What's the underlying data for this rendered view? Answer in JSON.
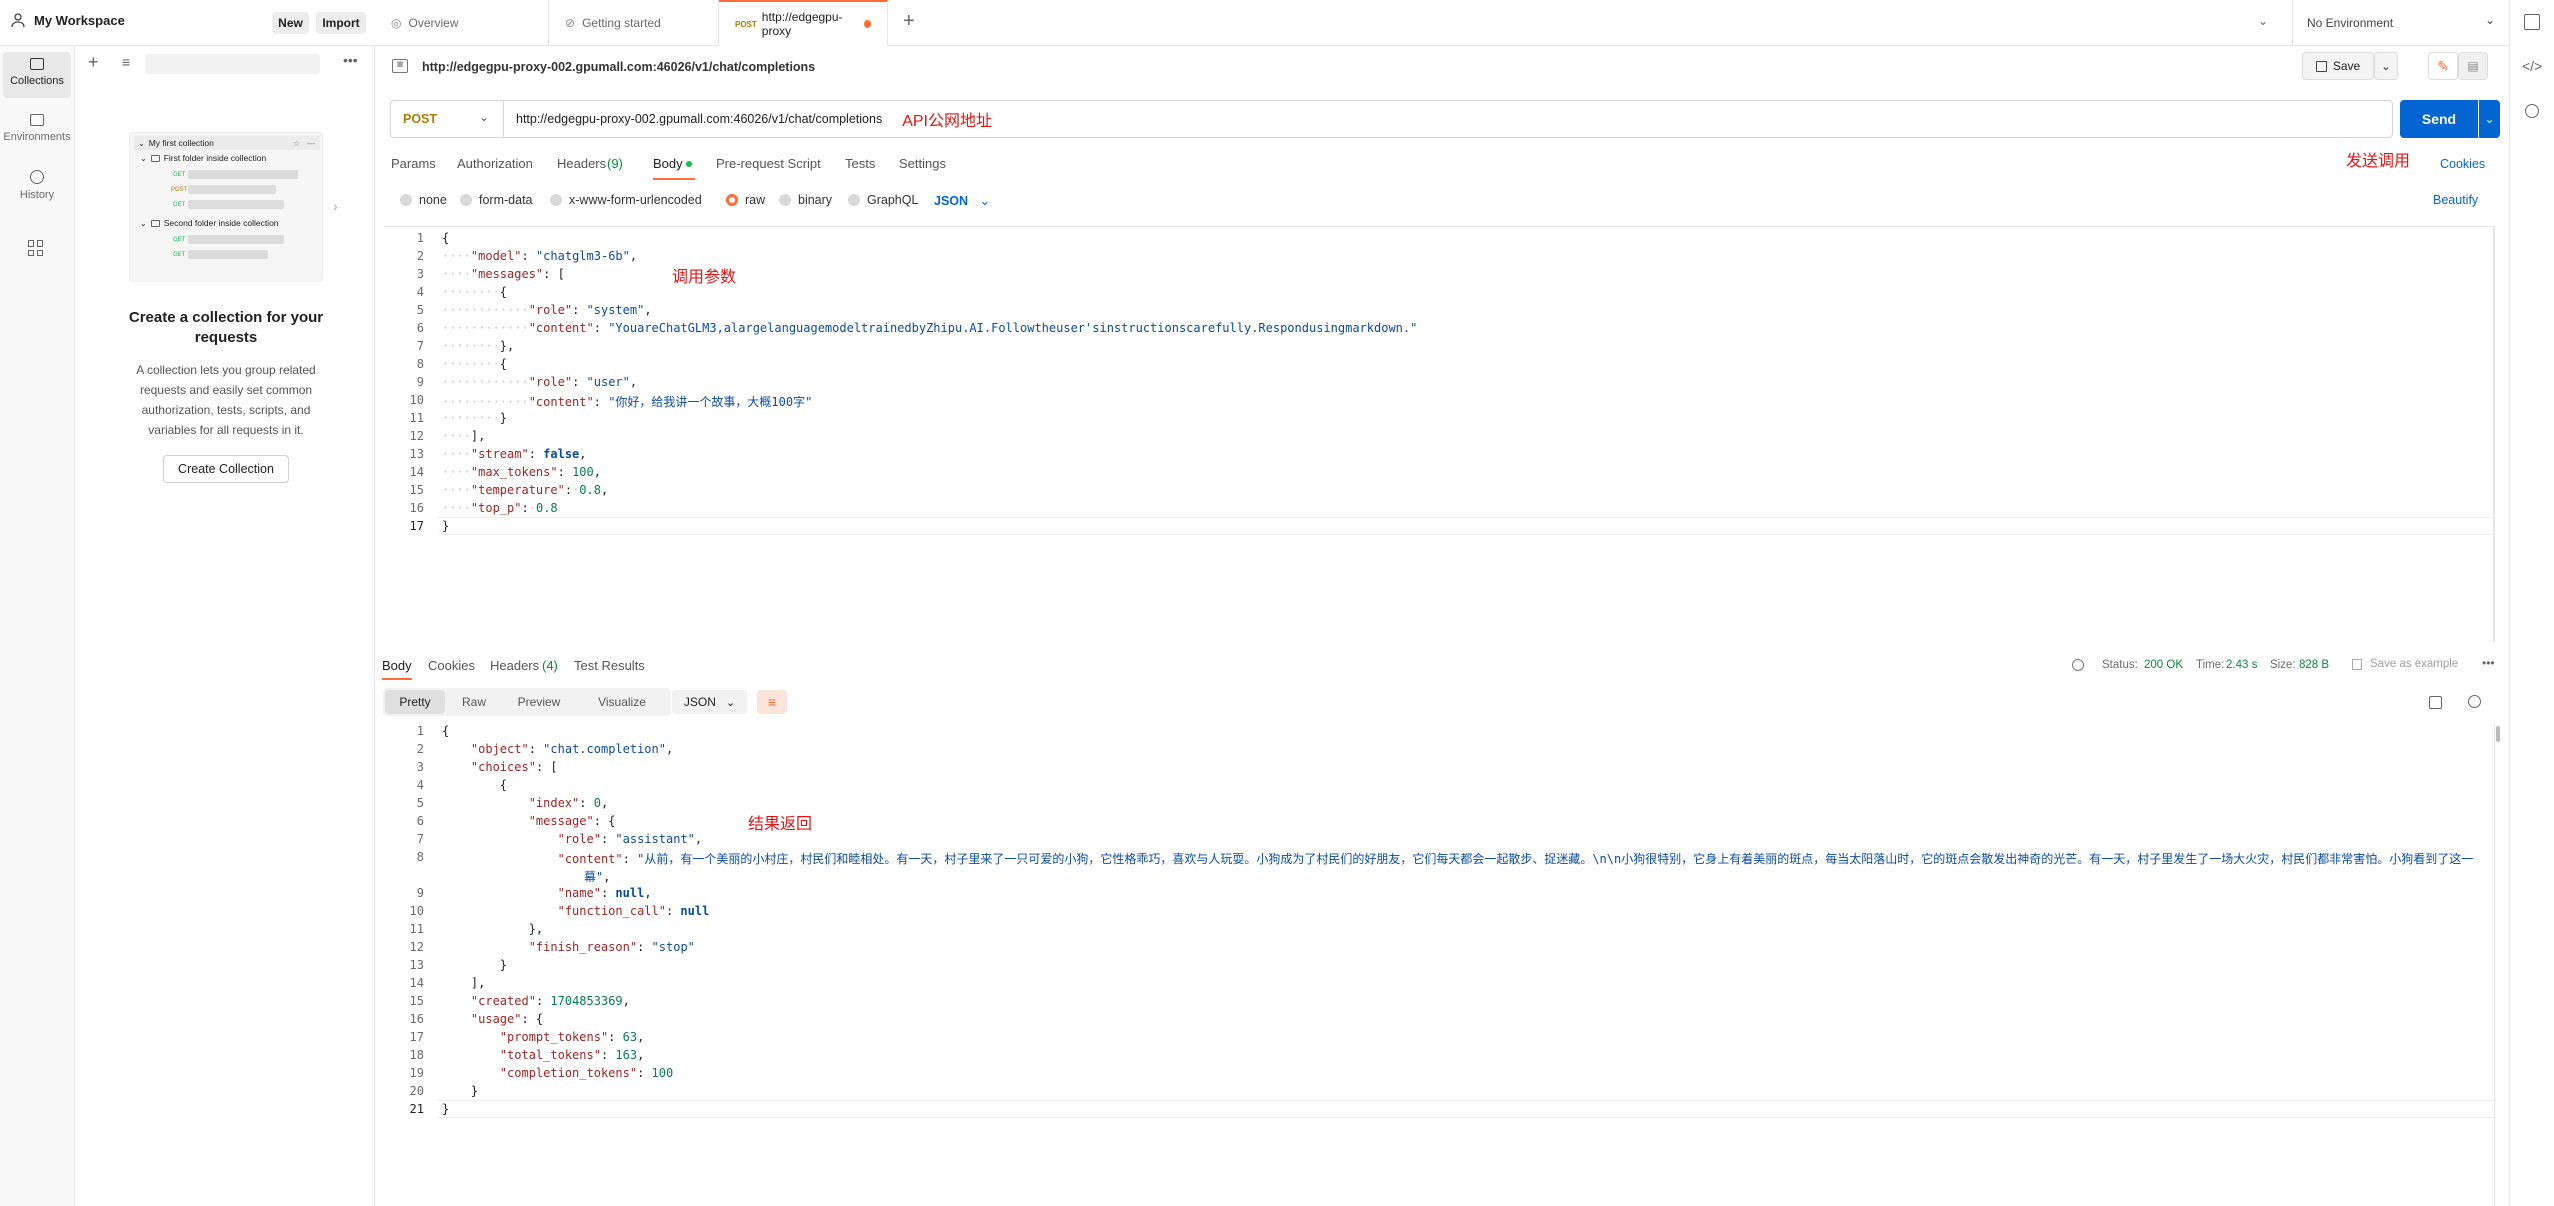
{
  "workspace": {
    "name": "My Workspace",
    "new_label": "New",
    "import_label": "Import"
  },
  "tabs": [
    {
      "label": "Overview"
    },
    {
      "label": "Getting started"
    },
    {
      "method": "POST",
      "label": "http://edgegpu-proxy"
    }
  ],
  "environment": {
    "label": "No Environment"
  },
  "rail": [
    {
      "label": "Collections"
    },
    {
      "label": "Environments"
    },
    {
      "label": "History"
    }
  ],
  "sidebar": {
    "collection_name": "My first collection",
    "folders": [
      {
        "name": "First folder inside collection",
        "methods": [
          "GET",
          "POST",
          "GET"
        ]
      },
      {
        "name": "Second folder inside collection",
        "methods": [
          "GET",
          "GET"
        ]
      }
    ],
    "empty_title": "Create a collection for your requests",
    "empty_desc": "A collection lets you group related requests and easily set common authorization, tests, scripts, and variables for all requests in it.",
    "create_button": "Create Collection"
  },
  "request": {
    "title": "http://edgegpu-proxy-002.gpumall.com:46026/v1/chat/completions",
    "save_label": "Save",
    "method": "POST",
    "url": "http://edgegpu-proxy-002.gpumall.com:46026/v1/chat/completions",
    "send_label": "Send",
    "tabs": [
      "Params",
      "Authorization",
      "Headers",
      "Body",
      "Pre-request Script",
      "Tests",
      "Settings"
    ],
    "headers_count": "(9)",
    "cookies_label": "Cookies",
    "body_modes": [
      "none",
      "form-data",
      "x-www-form-urlencoded",
      "raw",
      "binary",
      "GraphQL"
    ],
    "body_format": "JSON",
    "beautify_label": "Beautify"
  },
  "annotations": {
    "api_address": "API公网地址",
    "send_call": "发送调用",
    "call_params": "调用参数",
    "result_return": "结果返回"
  },
  "request_body": {
    "model": "chatglm3-6b",
    "system_role": "system",
    "system_content": "YouareChatGLM3,alargelanguagemodeltrainedbyZhipu.AI.Followtheuser'sinstructionscarefully.Respondusingmarkdown.",
    "user_role": "user",
    "user_content": "你好，给我讲一个故事，大概100字",
    "stream": "false",
    "max_tokens": "100",
    "temperature": "0.8",
    "top_p": "0.8"
  },
  "response": {
    "tabs": [
      "Body",
      "Cookies",
      "Headers",
      "Test Results"
    ],
    "headers_count": "(4)",
    "status_label": "Status:",
    "status": "200 OK",
    "time_label": "Time:",
    "time": "2.43 s",
    "size_label": "Size:",
    "size": "828 B",
    "save_example": "Save as example",
    "view_modes": [
      "Pretty",
      "Raw",
      "Preview",
      "Visualize"
    ],
    "format": "JSON"
  },
  "response_body": {
    "object": "chat.completion",
    "index": "0",
    "role": "assistant",
    "content_line1": "从前，有一个美丽的小村庄，村民们和睦相处。有一天，村子里来了一只可爱的小狗，它性格乖巧，喜欢与人玩耍。小狗成为了村民们的好朋友，它们每天都会一起散步、捉迷藏。\\n\\n小狗很特别，它身上有着美丽的斑点，每当太阳落山时，它的斑点会散发出神奇的光芒。有一天，村子里发生了一场大火灾，村民们都非常害怕。小狗看到了这一",
    "content_line2": "幕",
    "name": "null",
    "function_call": "null",
    "finish_reason": "stop",
    "created": "1704853369",
    "prompt_tokens": "63",
    "total_tokens": "163",
    "completion_tokens": "100"
  },
  "colors": {
    "accent": "#ff6c37",
    "send": "#0265d2",
    "status_ok": "#0a8a3a"
  }
}
